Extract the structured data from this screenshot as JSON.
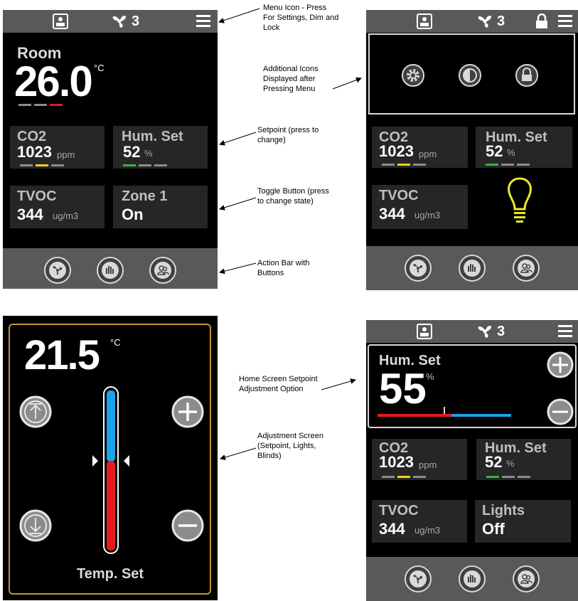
{
  "screens": {
    "home": {
      "fan_speed": "3",
      "room_label": "Room",
      "room_temp": "26.0",
      "temp_unit": "°C",
      "tiles": [
        {
          "label": "CO2",
          "value": "1023",
          "unit": "ppm"
        },
        {
          "label": "Hum. Set",
          "value": "52",
          "unit": "%"
        },
        {
          "label": "TVOC",
          "value": "344",
          "unit": "ug/m3"
        },
        {
          "label": "Zone 1",
          "value": "On",
          "unit": ""
        }
      ]
    },
    "menu": {
      "fan_speed": "3",
      "tiles": [
        {
          "label": "CO2",
          "value": "1023",
          "unit": "ppm"
        },
        {
          "label": "Hum. Set",
          "value": "52",
          "unit": "%"
        },
        {
          "label": "TVOC",
          "value": "344",
          "unit": "ug/m3"
        }
      ]
    },
    "adjust": {
      "value": "21.5",
      "unit": "°C",
      "label": "Temp. Set"
    },
    "setpoint": {
      "fan_speed": "3",
      "hum_label": "Hum. Set",
      "hum_value": "55",
      "hum_unit": "%",
      "tiles": [
        {
          "label": "CO2",
          "value": "1023",
          "unit": "ppm"
        },
        {
          "label": "Hum. Set",
          "value": "52",
          "unit": "%"
        },
        {
          "label": "TVOC",
          "value": "344",
          "unit": "ug/m3"
        },
        {
          "label": "Lights",
          "value": "Off",
          "unit": ""
        }
      ]
    }
  },
  "annotations": {
    "menu_icon": "Menu Icon - Press For Settings, Dim and Lock",
    "additional_icons": "Additional Icons Displayed after Pressing Menu",
    "setpoint": "Setpoint (press to change)",
    "toggle": "Toggle Button (press to change state)",
    "action_bar": "Action Bar with Buttons",
    "home_setpoint": "Home Screen Setpoint Adjustment Option",
    "adjust_screen": "Adjustment Screen (Setpoint, Lights, Blinds)"
  },
  "colors": {
    "bar_grey": "#595959",
    "tile_bg": "#262626",
    "accent_red": "#e31a1c",
    "accent_yellow": "#f2d024",
    "accent_green": "#3cb043",
    "accent_blue": "#1ca3e8",
    "frame_orange": "#c8923a",
    "bulb_yellow": "#e8e82a"
  },
  "icons": [
    "home-device-icon",
    "fan-icon",
    "menu-icon",
    "lock-icon",
    "gear-icon",
    "contrast-icon",
    "lock-circle-icon",
    "lightbulb-icon",
    "up-arrow-icon",
    "down-arrow-icon",
    "plus-icon",
    "minus-icon",
    "bar-chart-icon",
    "people-icon"
  ]
}
